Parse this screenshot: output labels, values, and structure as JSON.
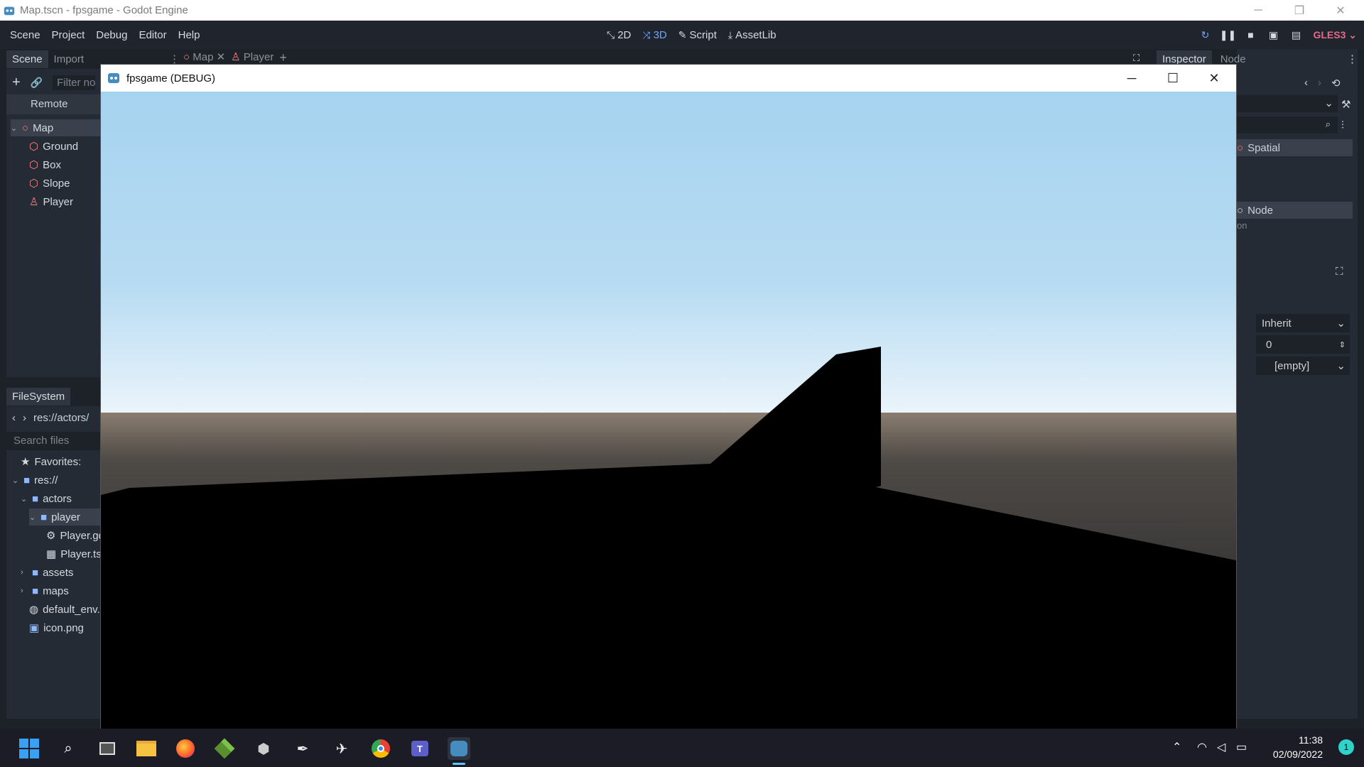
{
  "window": {
    "title": "Map.tscn - fpsgame - Godot Engine"
  },
  "menu": {
    "items": [
      "Scene",
      "Project",
      "Debug",
      "Editor",
      "Help"
    ]
  },
  "workspaces": {
    "btn_2d": "2D",
    "btn_3d": "3D",
    "btn_script": "Script",
    "btn_assetlib": "AssetLib"
  },
  "renderer": "GLES3",
  "scene_dock": {
    "tabs": [
      "Scene",
      "Import"
    ],
    "filter_placeholder": "Filter no",
    "remote_label": "Remote",
    "nodes": [
      {
        "label": "Map",
        "icon": "spatial-icon"
      },
      {
        "label": "Ground",
        "icon": "mesh-instance-icon"
      },
      {
        "label": "Box",
        "icon": "mesh-instance-icon"
      },
      {
        "label": "Slope",
        "icon": "mesh-instance-icon"
      },
      {
        "label": "Player",
        "icon": "kinematic-body-icon"
      }
    ]
  },
  "editor_tabs": {
    "tab1": "Map",
    "tab2": "Player"
  },
  "filesystem": {
    "tab": "FileSystem",
    "path": "res://actors/",
    "search_placeholder": "Search files",
    "favorites": "Favorites:",
    "items": [
      "res://",
      "actors",
      "player",
      "Player.gd",
      "Player.tscn",
      "assets",
      "maps",
      "default_env.tres",
      "icon.png"
    ]
  },
  "inspector": {
    "tabs": [
      "Inspector",
      "Node"
    ],
    "section_spatial": "Spatial",
    "section_node": "Node",
    "partial_text": "on",
    "inherit_value": "Inherit",
    "number_value": "0",
    "empty_value": "[empty]"
  },
  "debug_window": {
    "title": "fpsgame (DEBUG)"
  },
  "colors": {
    "sky_top": "#a6d3f0",
    "sky_horizon": "#eaf4fb",
    "ground_far": "#4e4a46",
    "accent": "#6ea6ff",
    "gles": "#e46a8a"
  },
  "taskbar": {
    "time": "11:38",
    "date": "02/09/2022",
    "notifications": "1"
  }
}
